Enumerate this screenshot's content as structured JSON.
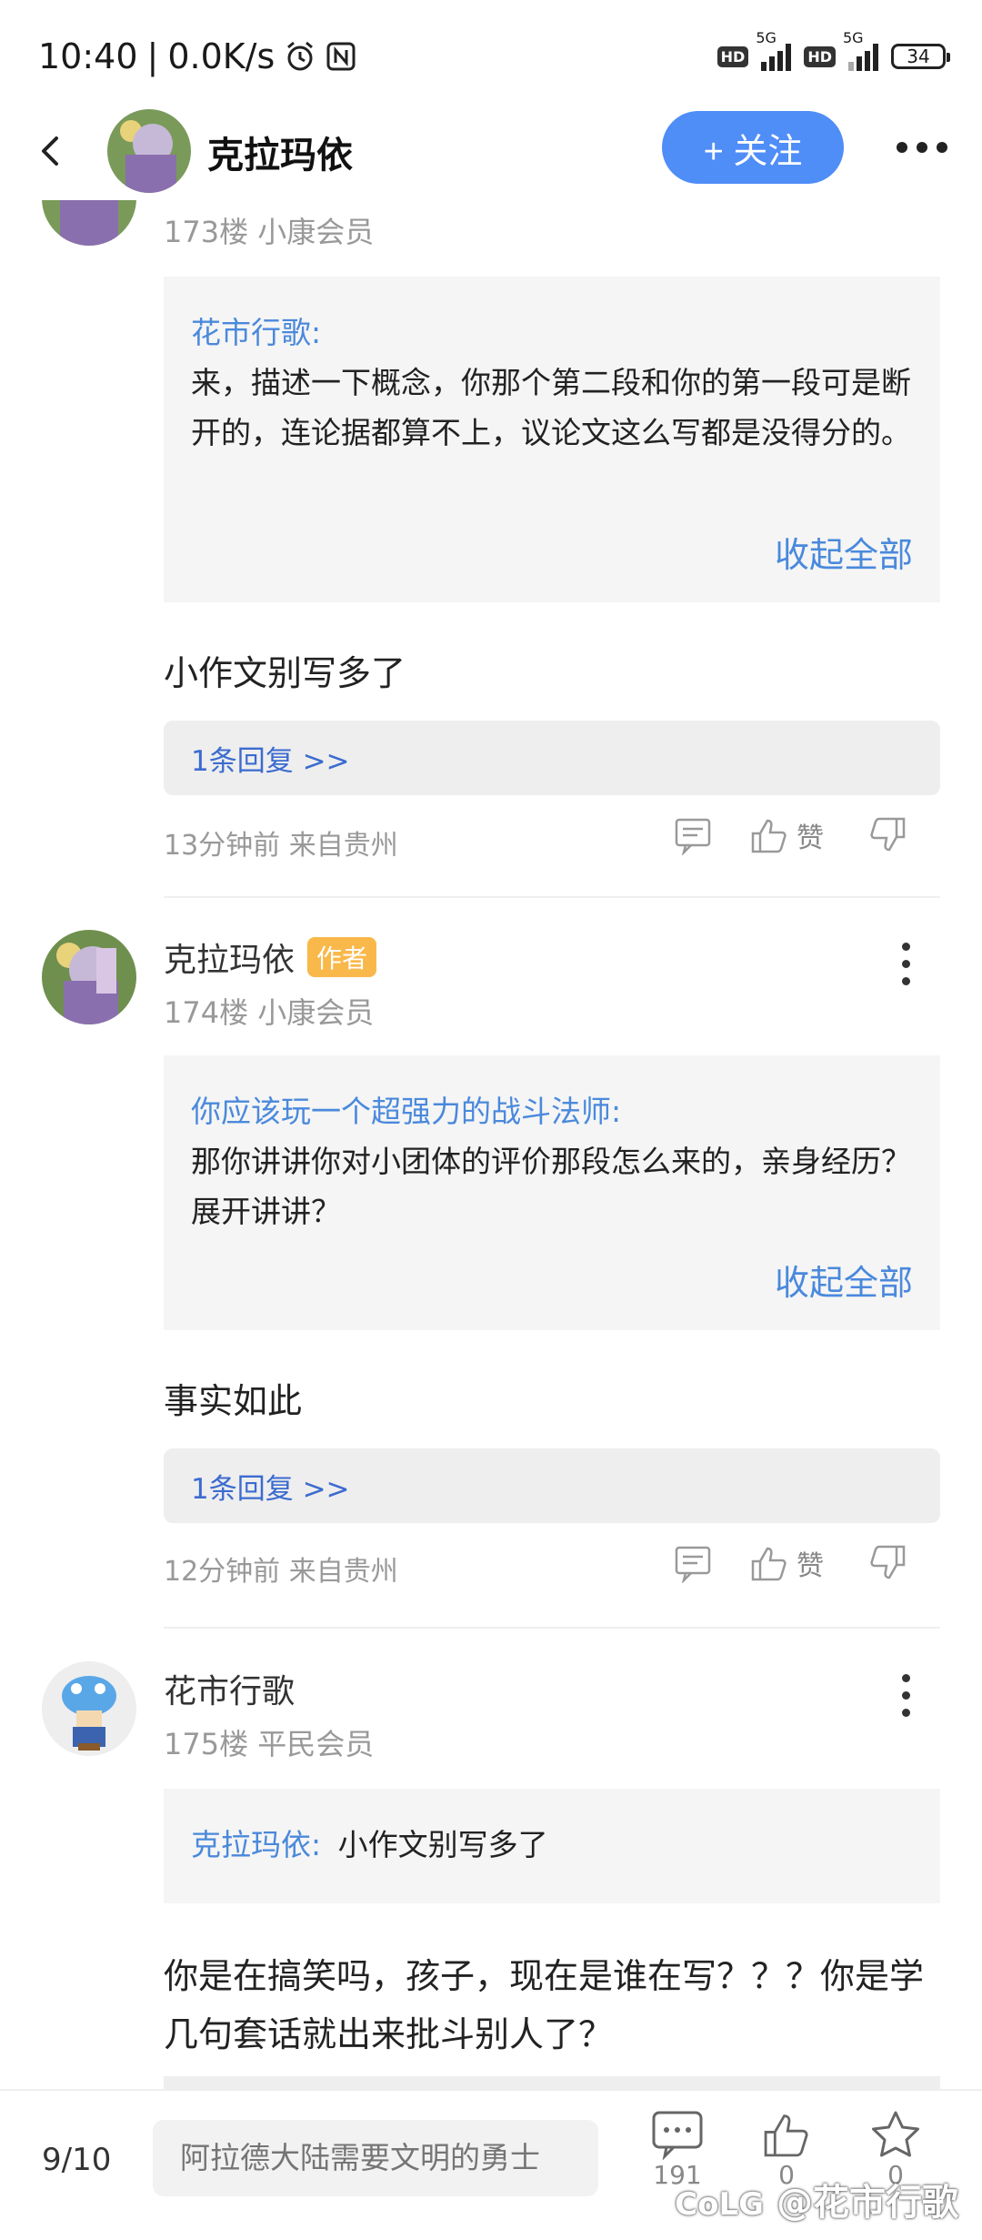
{
  "status": {
    "time": "10:40",
    "speed": "0.0K/s",
    "hd1": "HD",
    "gen1": "5G",
    "hd2": "HD",
    "gen2": "5G",
    "battery": "34"
  },
  "nav": {
    "title": "克拉玛依",
    "follow_label": "+ 关注"
  },
  "posts": [
    {
      "floor": "173楼",
      "level": "小康会员",
      "quote_author": "花市行歌:",
      "quote_text": "来，描述一下概念，你那个第二段和你的第一段可是断开的，连论据都算不上，议论文这么写都是没得分的。",
      "collapse_label": "收起全部",
      "text": "小作文别写多了",
      "replies_label": "1条回复 >>",
      "time": "13分钟前 来自贵州",
      "like_label": "赞"
    },
    {
      "username": "克拉玛依",
      "badge": "作者",
      "floor": "174楼",
      "level": "小康会员",
      "quote_author": "你应该玩一个超强力的战斗法师:",
      "quote_text": "那你讲讲你对小团体的评价那段怎么来的，亲身经历？展开讲讲？",
      "collapse_label": "收起全部",
      "text": "事实如此",
      "replies_label": "1条回复 >>",
      "time": "12分钟前 来自贵州",
      "like_label": "赞"
    },
    {
      "username": "花市行歌",
      "floor": "175楼",
      "level": "平民会员",
      "quote_author": "克拉玛依:",
      "quote_text": "小作文别写多了",
      "text": "你是在搞笑吗，孩子，现在是谁在写？？？你是学几句套话就出来批斗别人了？"
    }
  ],
  "bottom": {
    "page": "9/10",
    "input_placeholder": "阿拉德大陆需要文明的勇士",
    "comments": "191",
    "likes": "0",
    "favs": "0",
    "watermark": "@花市行歌"
  },
  "colors": {
    "accent": "#4f8df7",
    "link": "#4a89dc",
    "badge": "#f9b84a"
  }
}
